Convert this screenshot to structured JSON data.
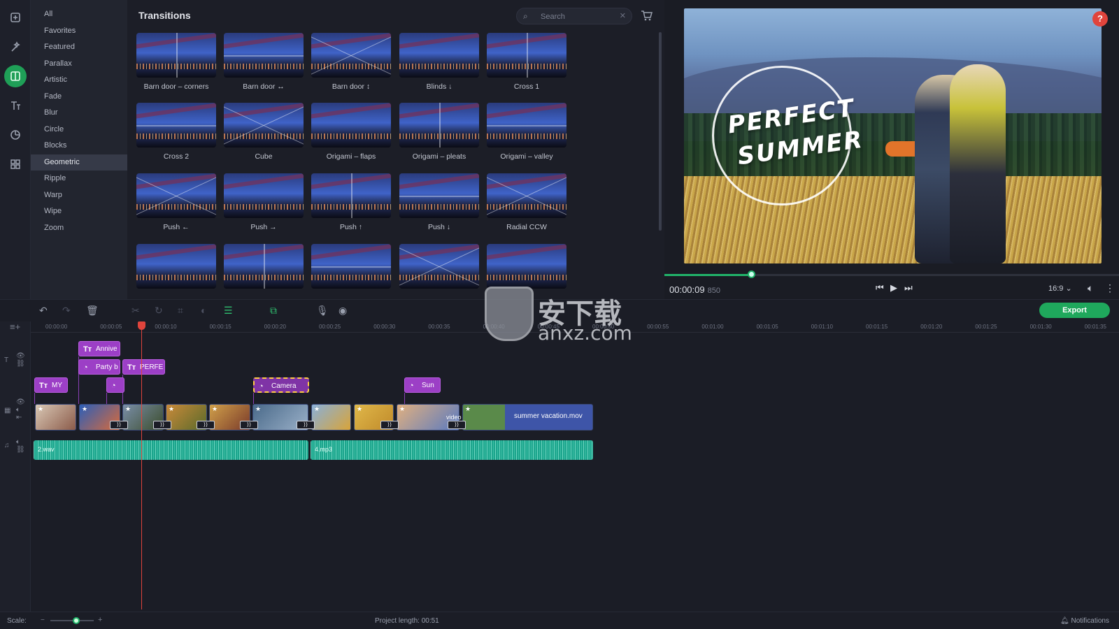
{
  "rail": {
    "items": [
      {
        "name": "import-icon",
        "glyph": "⊕"
      },
      {
        "name": "filters-icon",
        "glyph": "✧"
      },
      {
        "name": "transitions-icon",
        "glyph": "▥"
      },
      {
        "name": "titles-icon",
        "glyph": "Tт"
      },
      {
        "name": "stickers-icon",
        "glyph": "◔"
      },
      {
        "name": "more-tools-icon",
        "glyph": "⊞"
      }
    ],
    "active_index": 2
  },
  "categories": [
    "All",
    "Favorites",
    "Featured",
    "Parallax",
    "Artistic",
    "Fade",
    "Blur",
    "Circle",
    "Blocks",
    "Geometric",
    "Ripple",
    "Warp",
    "Wipe",
    "Zoom"
  ],
  "active_category": "Geometric",
  "transitions": {
    "title": "Transitions",
    "search_placeholder": "Search",
    "tiles": [
      "Barn door – corners",
      "Barn door ↔",
      "Barn door ↕",
      "Blinds ↓",
      "Cross 1",
      "Cross 2",
      "Cube",
      "Origami – flaps",
      "Origami – pleats",
      "Origami – valley",
      "Push ←",
      "Push →",
      "Push ↑",
      "Push ↓",
      "Radial CCW",
      "",
      "",
      "",
      "",
      ""
    ]
  },
  "preview": {
    "overlay_line1": "PERFECT",
    "overlay_line2": "SUMMER",
    "help": "?",
    "timecode": "00:00:09",
    "timecode_ms": "850",
    "progress": 0.19,
    "aspect": "16:9 ⌄"
  },
  "timeline": {
    "export_label": "Export",
    "ruler": [
      "00:00:00",
      "00:00:05",
      "00:00:10",
      "00:00:15",
      "00:00:20",
      "00:00:25",
      "00:00:30",
      "00:00:35",
      "00:00:40",
      "00:00:45",
      "00:00:50",
      "00:00:55",
      "00:01:00",
      "00:01:05",
      "00:01:10",
      "00:01:15",
      "00:01:20",
      "00:01:25",
      "00:01:30",
      "00:01:35"
    ],
    "title_clips": [
      {
        "label": "Annive",
        "icon": "Tт"
      },
      {
        "label": "Party b",
        "icon": "◔"
      },
      {
        "label": "PERFE",
        "icon": "Tт"
      },
      {
        "label": "MY",
        "icon": "Tт"
      },
      {
        "label": "",
        "icon": "◔"
      },
      {
        "label": "Camera",
        "icon": "◔"
      },
      {
        "label": "Sun",
        "icon": "◔"
      }
    ],
    "video_clip_name": "summer vacation.mov",
    "video_label": "video",
    "audio_clips": [
      {
        "label": "2.wav"
      },
      {
        "label": "4.mp3"
      }
    ]
  },
  "watermark": {
    "cn": "安下载",
    "en": "anxz.com"
  },
  "status": {
    "scale_label": "Scale:",
    "project_length": "Project length:  00:51",
    "notifications": "Notifications",
    "scale_value": 0.6
  }
}
